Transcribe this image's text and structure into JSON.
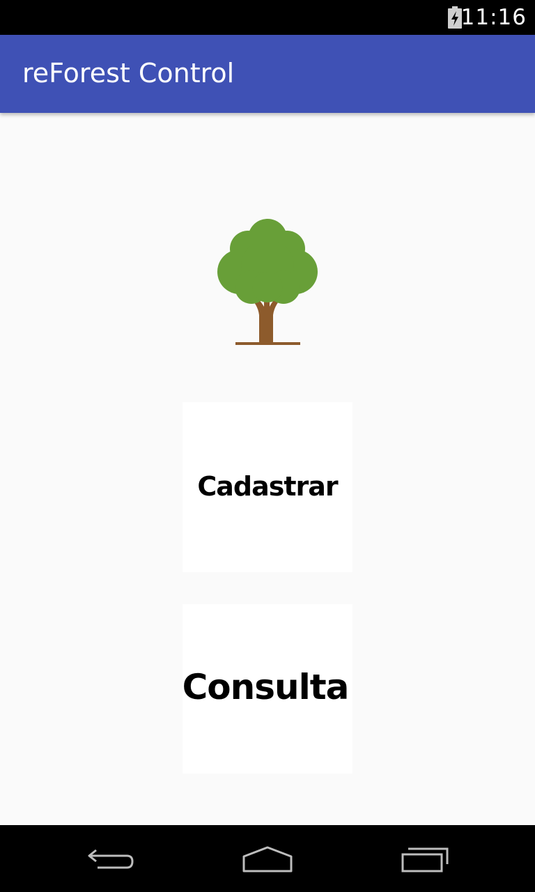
{
  "status_bar": {
    "time": "11:16",
    "battery_icon": "battery-charging-icon"
  },
  "app_bar": {
    "title": "reForest Control",
    "color": "#3f51b5"
  },
  "main": {
    "logo_icon": "tree-icon",
    "buttons": [
      {
        "label": "Cadastrar"
      },
      {
        "label": "Consulta"
      }
    ]
  },
  "nav_bar": {
    "icons": [
      "back-icon",
      "home-icon",
      "recents-icon"
    ]
  },
  "colors": {
    "primary": "#3f51b5",
    "background": "#fafafa",
    "tree_foliage": "#689f38",
    "tree_trunk": "#8d5b2c"
  }
}
